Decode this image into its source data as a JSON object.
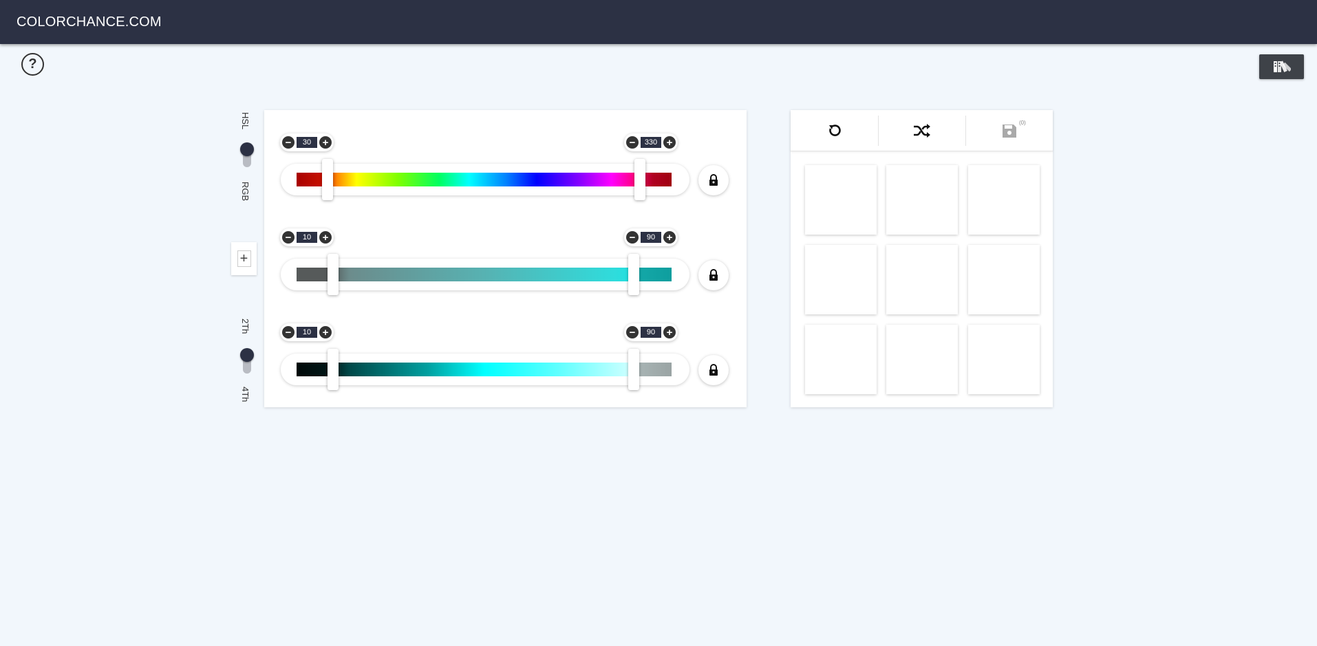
{
  "header": {
    "brand": "COLORCHANCE.COM"
  },
  "help": {
    "icon": "question-circle-icon",
    "glyph": "?"
  },
  "palette_button": {
    "icon": "palette-swatches-icon"
  },
  "mode_toggle": {
    "top_label": "HSL",
    "bottom_label": "RGB",
    "selected": "HSL"
  },
  "add_button": {
    "glyph": "+"
  },
  "tone_toggle": {
    "top_label": "2Th",
    "bottom_label": "4Th",
    "selected": "2Th"
  },
  "sliders": [
    {
      "name": "hue",
      "min": {
        "value": "30",
        "minus": "−",
        "plus": "+"
      },
      "max": {
        "value": "330",
        "minus": "−",
        "plus": "+"
      },
      "locked": true
    },
    {
      "name": "saturation",
      "min": {
        "value": "10",
        "minus": "−",
        "plus": "+"
      },
      "max": {
        "value": "90",
        "minus": "−",
        "plus": "+"
      },
      "locked": true
    },
    {
      "name": "lightness",
      "min": {
        "value": "10",
        "minus": "−",
        "plus": "+"
      },
      "max": {
        "value": "90",
        "minus": "−",
        "plus": "+"
      },
      "locked": true
    }
  ],
  "toolbar": {
    "reset_icon": "reset-icon",
    "shuffle_icon": "shuffle-icon",
    "save_icon": "save-disk-icon",
    "save_count": "(0)"
  },
  "swatches": [
    "#ffffff",
    "#ffffff",
    "#ffffff",
    "#ffffff",
    "#ffffff",
    "#ffffff",
    "#ffffff",
    "#ffffff",
    "#ffffff"
  ],
  "colors": {
    "header_bg": "#2c3144",
    "page_bg": "#f2f7fc",
    "accent": "#2c3144"
  }
}
